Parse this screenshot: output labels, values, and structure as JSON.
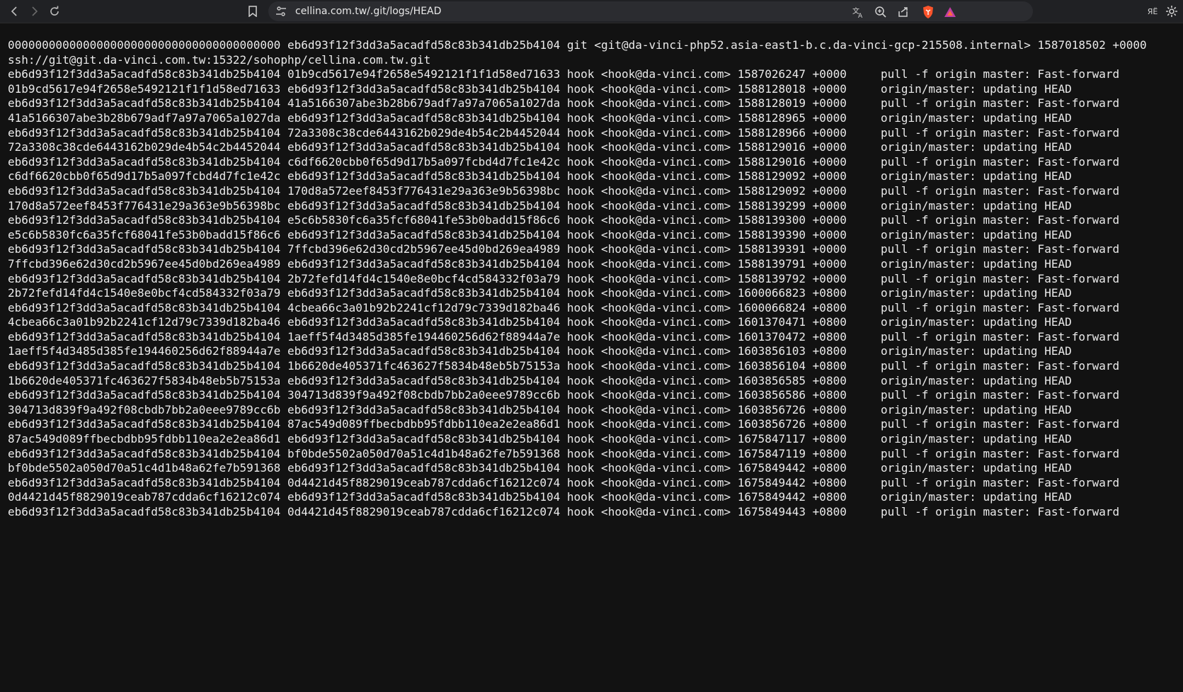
{
  "browser": {
    "url": "cellina.com.tw/.git/logs/HEAD",
    "icons": {
      "back": "arrow-left-icon",
      "forward": "arrow-right-icon",
      "reload": "reload-icon",
      "bookmark": "bookmark-icon",
      "site_info": "tune-icon",
      "translate": "translate-icon",
      "zoom": "zoom-icon",
      "share": "share-icon",
      "brave": "brave-shield-icon",
      "rewards": "rewards-triangle-icon",
      "extensions": "extension-icon",
      "settings": "gear-icon"
    },
    "extension_label": "ЯЁ",
    "accent": "#fb542b"
  },
  "log": {
    "lines": [
      "0000000000000000000000000000000000000000 eb6d93f12f3dd3a5acadfd58c83b341db25b4104 git <git@da-vinci-php52.asia-east1-b.c.da-vinci-gcp-215508.internal> 1587018502 +0000",
      "ssh://git@git.da-vinci.com.tw:15322/sohophp/cellina.com.tw.git",
      "eb6d93f12f3dd3a5acadfd58c83b341db25b4104 01b9cd5617e94f2658e5492121f1f1d58ed71633 hook <hook@da-vinci.com> 1587026247 +0000     pull -f origin master: Fast-forward",
      "01b9cd5617e94f2658e5492121f1f1d58ed71633 eb6d93f12f3dd3a5acadfd58c83b341db25b4104 hook <hook@da-vinci.com> 1588128018 +0000     origin/master: updating HEAD",
      "eb6d93f12f3dd3a5acadfd58c83b341db25b4104 41a5166307abe3b28b679adf7a97a7065a1027da hook <hook@da-vinci.com> 1588128019 +0000     pull -f origin master: Fast-forward",
      "41a5166307abe3b28b679adf7a97a7065a1027da eb6d93f12f3dd3a5acadfd58c83b341db25b4104 hook <hook@da-vinci.com> 1588128965 +0000     origin/master: updating HEAD",
      "eb6d93f12f3dd3a5acadfd58c83b341db25b4104 72a3308c38cde6443162b029de4b54c2b4452044 hook <hook@da-vinci.com> 1588128966 +0000     pull -f origin master: Fast-forward",
      "72a3308c38cde6443162b029de4b54c2b4452044 eb6d93f12f3dd3a5acadfd58c83b341db25b4104 hook <hook@da-vinci.com> 1588129016 +0000     origin/master: updating HEAD",
      "eb6d93f12f3dd3a5acadfd58c83b341db25b4104 c6df6620cbb0f65d9d17b5a097fcbd4d7fc1e42c hook <hook@da-vinci.com> 1588129016 +0000     pull -f origin master: Fast-forward",
      "c6df6620cbb0f65d9d17b5a097fcbd4d7fc1e42c eb6d93f12f3dd3a5acadfd58c83b341db25b4104 hook <hook@da-vinci.com> 1588129092 +0000     origin/master: updating HEAD",
      "eb6d93f12f3dd3a5acadfd58c83b341db25b4104 170d8a572eef8453f776431e29a363e9b56398bc hook <hook@da-vinci.com> 1588129092 +0000     pull -f origin master: Fast-forward",
      "170d8a572eef8453f776431e29a363e9b56398bc eb6d93f12f3dd3a5acadfd58c83b341db25b4104 hook <hook@da-vinci.com> 1588139299 +0000     origin/master: updating HEAD",
      "eb6d93f12f3dd3a5acadfd58c83b341db25b4104 e5c6b5830fc6a35fcf68041fe53b0badd15f86c6 hook <hook@da-vinci.com> 1588139300 +0000     pull -f origin master: Fast-forward",
      "e5c6b5830fc6a35fcf68041fe53b0badd15f86c6 eb6d93f12f3dd3a5acadfd58c83b341db25b4104 hook <hook@da-vinci.com> 1588139390 +0000     origin/master: updating HEAD",
      "eb6d93f12f3dd3a5acadfd58c83b341db25b4104 7ffcbd396e62d30cd2b5967ee45d0bd269ea4989 hook <hook@da-vinci.com> 1588139391 +0000     pull -f origin master: Fast-forward",
      "7ffcbd396e62d30cd2b5967ee45d0bd269ea4989 eb6d93f12f3dd3a5acadfd58c83b341db25b4104 hook <hook@da-vinci.com> 1588139791 +0000     origin/master: updating HEAD",
      "eb6d93f12f3dd3a5acadfd58c83b341db25b4104 2b72fefd14fd4c1540e8e0bcf4cd584332f03a79 hook <hook@da-vinci.com> 1588139792 +0000     pull -f origin master: Fast-forward",
      "2b72fefd14fd4c1540e8e0bcf4cd584332f03a79 eb6d93f12f3dd3a5acadfd58c83b341db25b4104 hook <hook@da-vinci.com> 1600066823 +0800     origin/master: updating HEAD",
      "eb6d93f12f3dd3a5acadfd58c83b341db25b4104 4cbea66c3a01b92b2241cf12d79c7339d182ba46 hook <hook@da-vinci.com> 1600066824 +0800     pull -f origin master: Fast-forward",
      "4cbea66c3a01b92b2241cf12d79c7339d182ba46 eb6d93f12f3dd3a5acadfd58c83b341db25b4104 hook <hook@da-vinci.com> 1601370471 +0800     origin/master: updating HEAD",
      "eb6d93f12f3dd3a5acadfd58c83b341db25b4104 1aeff5f4d3485d385fe194460256d62f88944a7e hook <hook@da-vinci.com> 1601370472 +0800     pull -f origin master: Fast-forward",
      "1aeff5f4d3485d385fe194460256d62f88944a7e eb6d93f12f3dd3a5acadfd58c83b341db25b4104 hook <hook@da-vinci.com> 1603856103 +0800     origin/master: updating HEAD",
      "eb6d93f12f3dd3a5acadfd58c83b341db25b4104 1b6620de405371fc463627f5834b48eb5b75153a hook <hook@da-vinci.com> 1603856104 +0800     pull -f origin master: Fast-forward",
      "1b6620de405371fc463627f5834b48eb5b75153a eb6d93f12f3dd3a5acadfd58c83b341db25b4104 hook <hook@da-vinci.com> 1603856585 +0800     origin/master: updating HEAD",
      "eb6d93f12f3dd3a5acadfd58c83b341db25b4104 304713d839f9a492f08cbdb7bb2a0eee9789cc6b hook <hook@da-vinci.com> 1603856586 +0800     pull -f origin master: Fast-forward",
      "304713d839f9a492f08cbdb7bb2a0eee9789cc6b eb6d93f12f3dd3a5acadfd58c83b341db25b4104 hook <hook@da-vinci.com> 1603856726 +0800     origin/master: updating HEAD",
      "eb6d93f12f3dd3a5acadfd58c83b341db25b4104 87ac549d089ffbecbdbb95fdbb110ea2e2ea86d1 hook <hook@da-vinci.com> 1603856726 +0800     pull -f origin master: Fast-forward",
      "87ac549d089ffbecbdbb95fdbb110ea2e2ea86d1 eb6d93f12f3dd3a5acadfd58c83b341db25b4104 hook <hook@da-vinci.com> 1675847117 +0800     origin/master: updating HEAD",
      "eb6d93f12f3dd3a5acadfd58c83b341db25b4104 bf0bde5502a050d70a51c4d1b48a62fe7b591368 hook <hook@da-vinci.com> 1675847119 +0800     pull -f origin master: Fast-forward",
      "bf0bde5502a050d70a51c4d1b48a62fe7b591368 eb6d93f12f3dd3a5acadfd58c83b341db25b4104 hook <hook@da-vinci.com> 1675849442 +0800     origin/master: updating HEAD",
      "eb6d93f12f3dd3a5acadfd58c83b341db25b4104 0d4421d45f8829019ceab787cdda6cf16212c074 hook <hook@da-vinci.com> 1675849442 +0800     pull -f origin master: Fast-forward",
      "0d4421d45f8829019ceab787cdda6cf16212c074 eb6d93f12f3dd3a5acadfd58c83b341db25b4104 hook <hook@da-vinci.com> 1675849442 +0800     origin/master: updating HEAD",
      "eb6d93f12f3dd3a5acadfd58c83b341db25b4104 0d4421d45f8829019ceab787cdda6cf16212c074 hook <hook@da-vinci.com> 1675849443 +0800     pull -f origin master: Fast-forward"
    ]
  }
}
